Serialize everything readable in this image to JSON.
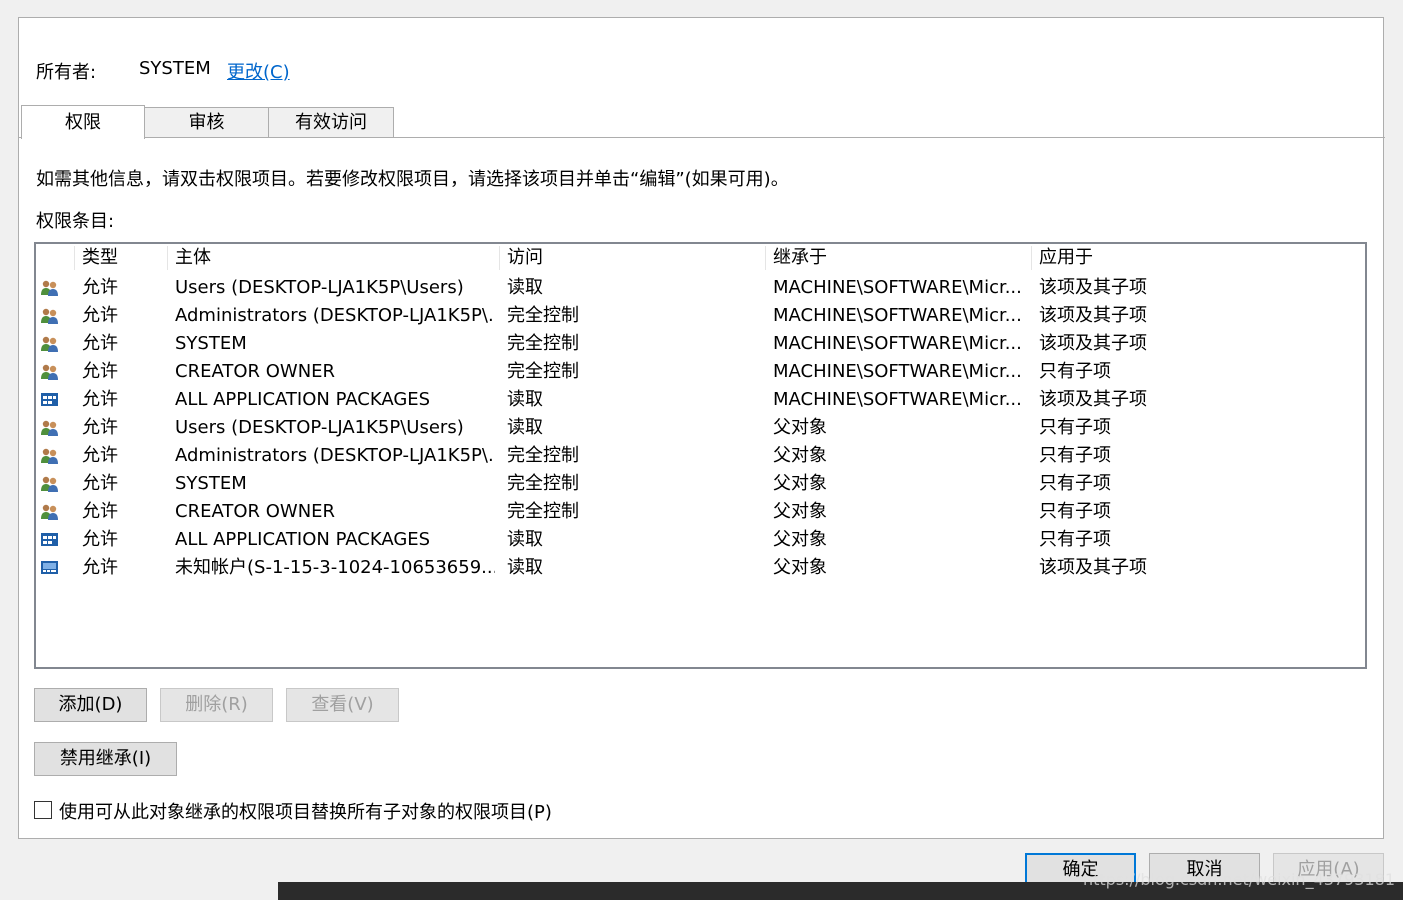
{
  "owner": {
    "label": "所有者:",
    "value": "SYSTEM",
    "change_link": "更改(C)"
  },
  "tabs": [
    {
      "label": "权限",
      "active": true
    },
    {
      "label": "审核",
      "active": false
    },
    {
      "label": "有效访问",
      "active": false
    }
  ],
  "info_text": "如需其他信息，请双击权限项目。若要修改权限项目，请选择该项目并单击“编辑”(如果可用)。",
  "entries_label": "权限条目:",
  "columns": [
    "类型",
    "主体",
    "访问",
    "继承于",
    "应用于"
  ],
  "rows": [
    {
      "icon": "users-group-icon",
      "type": "允许",
      "principal": "Users (DESKTOP-LJA1K5P\\Users)",
      "access": "读取",
      "inherited_from": "MACHINE\\SOFTWARE\\Micr...",
      "applies_to": "该项及其子项"
    },
    {
      "icon": "users-group-icon",
      "type": "允许",
      "principal": "Administrators (DESKTOP-LJA1K5P\\...",
      "access": "完全控制",
      "inherited_from": "MACHINE\\SOFTWARE\\Micr...",
      "applies_to": "该项及其子项"
    },
    {
      "icon": "users-group-icon",
      "type": "允许",
      "principal": "SYSTEM",
      "access": "完全控制",
      "inherited_from": "MACHINE\\SOFTWARE\\Micr...",
      "applies_to": "该项及其子项"
    },
    {
      "icon": "users-group-icon",
      "type": "允许",
      "principal": "CREATOR OWNER",
      "access": "完全控制",
      "inherited_from": "MACHINE\\SOFTWARE\\Micr...",
      "applies_to": "只有子项"
    },
    {
      "icon": "app-packages-icon",
      "type": "允许",
      "principal": "ALL APPLICATION PACKAGES",
      "access": "读取",
      "inherited_from": "MACHINE\\SOFTWARE\\Micr...",
      "applies_to": "该项及其子项"
    },
    {
      "icon": "users-group-icon",
      "type": "允许",
      "principal": "Users (DESKTOP-LJA1K5P\\Users)",
      "access": "读取",
      "inherited_from": "父对象",
      "applies_to": "只有子项"
    },
    {
      "icon": "users-group-icon",
      "type": "允许",
      "principal": "Administrators (DESKTOP-LJA1K5P\\...",
      "access": "完全控制",
      "inherited_from": "父对象",
      "applies_to": "只有子项"
    },
    {
      "icon": "users-group-icon",
      "type": "允许",
      "principal": "SYSTEM",
      "access": "完全控制",
      "inherited_from": "父对象",
      "applies_to": "只有子项"
    },
    {
      "icon": "users-group-icon",
      "type": "允许",
      "principal": "CREATOR OWNER",
      "access": "完全控制",
      "inherited_from": "父对象",
      "applies_to": "只有子项"
    },
    {
      "icon": "app-packages-icon",
      "type": "允许",
      "principal": "ALL APPLICATION PACKAGES",
      "access": "读取",
      "inherited_from": "父对象",
      "applies_to": "只有子项"
    },
    {
      "icon": "unknown-account-icon",
      "type": "允许",
      "principal": "未知帐户(S-1-15-3-1024-10653659...",
      "access": "读取",
      "inherited_from": "父对象",
      "applies_to": "该项及其子项"
    }
  ],
  "buttons": {
    "add": "添加(D)",
    "remove": "删除(R)",
    "view": "查看(V)",
    "disable_inheritance": "禁用继承(I)"
  },
  "replace_checkbox": {
    "label": "使用可从此对象继承的权限项目替换所有子对象的权限项目(P)",
    "checked": false
  },
  "footer_buttons": {
    "ok": "确定",
    "cancel": "取消",
    "apply": "应用(A)"
  },
  "watermark": "https://blog.csdn.net/weixin_43793181",
  "colors": {
    "link": "#0066cc",
    "default_button_border": "#0078d7"
  }
}
